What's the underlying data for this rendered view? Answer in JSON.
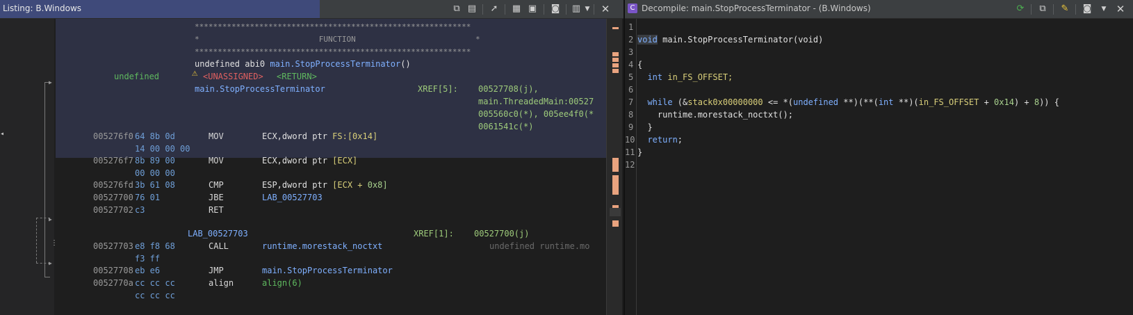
{
  "listing": {
    "title": "Listing:  B.Windows",
    "banner": {
      "stars": "************************************************************",
      "function_line": "*                          FUNCTION                          *"
    },
    "header": {
      "signature_kw": "undefined abi0",
      "signature_name": "main.StopProcessTerminator",
      "signature_paren": "()",
      "return_type": "undefined",
      "unassigned": "<UNASSIGNED>",
      "return": "<RETURN>",
      "func_label": "main.StopProcessTerminator",
      "xref_label": "XREF[5]:",
      "xref_lines": [
        "00527708(j),",
        "main.ThreadedMain:00527",
        "005560c0(*), 005ee4f0(*",
        "0061541c(*)"
      ]
    },
    "instructions": [
      {
        "addr": "005276f0",
        "bytes": "64 8b 0d",
        "bytes2": "14 00 00 00",
        "mnem": "MOV",
        "op1": "ECX,dword ptr ",
        "op2": "FS:[0x14]",
        "op3": ""
      },
      {
        "addr": "005276f7",
        "bytes": "8b 89 00",
        "bytes2": "00 00 00",
        "mnem": "MOV",
        "op1": "ECX,dword ptr ",
        "op2": "[ECX]",
        "op3": ""
      },
      {
        "addr": "005276fd",
        "bytes": "3b 61 08",
        "bytes2": "",
        "mnem": "CMP",
        "op1": "ESP,dword ptr ",
        "op2": "[ECX + ",
        "op3": "0x8]"
      },
      {
        "addr": "00527700",
        "bytes": "76 01",
        "bytes2": "",
        "mnem": "JBE",
        "op1": "LAB_00527703",
        "op2": "",
        "op3": ""
      },
      {
        "addr": "00527702",
        "bytes": "c3",
        "bytes2": "",
        "mnem": "RET",
        "op1": "",
        "op2": "",
        "op3": ""
      }
    ],
    "label2": "LAB_00527703",
    "xref2_label": "XREF[1]:",
    "xref2_value": "00527700(j)",
    "call": {
      "addr": "00527703",
      "bytes": "e8 f8 68",
      "bytes2": "f3 ff",
      "mnem": "CALL",
      "op": "runtime.morestack_noctxt",
      "comment": "undefined runtime.mo"
    },
    "jmp": {
      "addr": "00527708",
      "bytes": "eb e6",
      "mnem": "JMP",
      "op": "main.StopProcessTerminator"
    },
    "align": {
      "addr": "0052770a",
      "bytes": "cc cc cc",
      "bytes2": "cc cc cc",
      "mnem": "align",
      "op": "align(6)"
    }
  },
  "decompile": {
    "title": "Decompile: main.StopProcessTerminator -  (B.Windows)",
    "line_numbers": [
      "1",
      "2",
      "3",
      "4",
      "5",
      "6",
      "7",
      "8",
      "9",
      "10",
      "11",
      "12"
    ],
    "code": {
      "l2_void": "void",
      "l2_rest": " main.StopProcessTerminator(void)",
      "l4": "{",
      "l5_type": "  int",
      "l5_var": " in_FS_OFFSET;",
      "l7_while": "  while",
      "l7_a": " (&",
      "l7_stack": "stack0x00000000",
      "l7_b": " <= *(",
      "l7_undef": "undefined",
      "l7_c": " **)(**(",
      "l7_int": "int",
      "l7_d": " **)(",
      "l7_var": "in_FS_OFFSET",
      "l7_e": " + ",
      "l7_n1": "0x14",
      "l7_f": ") + ",
      "l7_n2": "8",
      "l7_g": ")) {",
      "l8": "    runtime.morestack_noctxt",
      "l8_b": "();",
      "l9": "  }",
      "l10_kw": "  return",
      "l10_b": ";",
      "l11": "}"
    }
  },
  "colors": {
    "accent": "#3f4a7a",
    "selection": "#2e3144"
  }
}
